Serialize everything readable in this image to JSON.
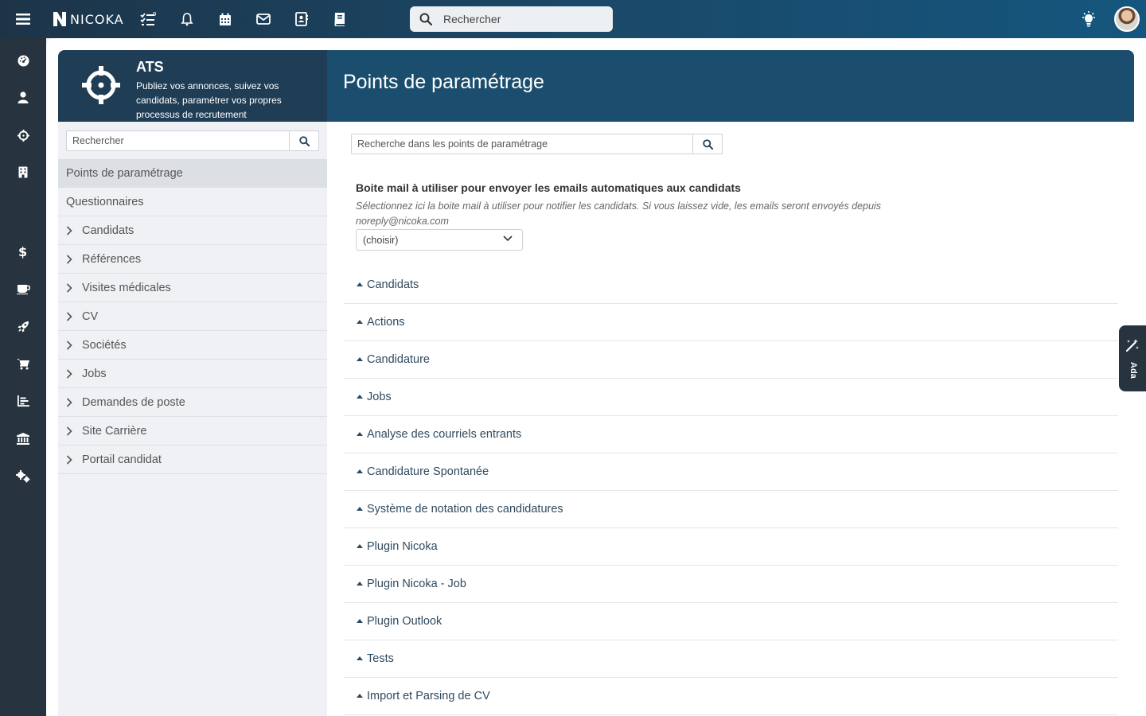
{
  "brand": {
    "name": "NICOKA"
  },
  "topbar": {
    "search_placeholder": "Rechercher",
    "icons": [
      "menu-icon",
      "tasks-icon",
      "bell-icon",
      "calendar-icon",
      "mail-icon",
      "contacts-icon",
      "book-icon",
      "lightbulb-icon"
    ]
  },
  "module": {
    "title": "ATS",
    "description": "Publiez vos annonces, suivez vos candidats, paramétrer vos propres processus de recrutement"
  },
  "left_search": {
    "placeholder": "Rechercher"
  },
  "nav": {
    "items": [
      {
        "label": "Points de paramétrage",
        "active": true,
        "chevron": false
      },
      {
        "label": "Questionnaires",
        "active": false,
        "chevron": false
      },
      {
        "label": "Candidats",
        "active": false,
        "chevron": true
      },
      {
        "label": "Références",
        "active": false,
        "chevron": true
      },
      {
        "label": "Visites médicales",
        "active": false,
        "chevron": true
      },
      {
        "label": "CV",
        "active": false,
        "chevron": true
      },
      {
        "label": "Sociétés",
        "active": false,
        "chevron": true
      },
      {
        "label": "Jobs",
        "active": false,
        "chevron": true
      },
      {
        "label": "Demandes de poste",
        "active": false,
        "chevron": true
      },
      {
        "label": "Site Carrière",
        "active": false,
        "chevron": true
      },
      {
        "label": "Portail candidat",
        "active": false,
        "chevron": true
      }
    ]
  },
  "content": {
    "title": "Points de paramétrage",
    "search_placeholder": "Recherche dans les points de paramétrage",
    "setting": {
      "label": "Boite mail à utiliser pour envoyer les emails automatiques aux candidats",
      "help": "Sélectionnez ici la boite mail à utiliser pour notifier les candidats. Si vous laissez vide, les emails seront envoyés depuis noreply@nicoka.com",
      "select_value": "(choisir)"
    },
    "sections": [
      "Candidats",
      "Actions",
      "Candidature",
      "Jobs",
      "Analyse des courriels entrants",
      "Candidature Spontanée",
      "Système de notation des candidatures",
      "Plugin Nicoka",
      "Plugin Nicoka - Job",
      "Plugin Outlook",
      "Tests",
      "Import et Parsing de CV"
    ]
  },
  "side_tab": {
    "label": "Ada"
  },
  "colors": {
    "topbar": "#1a4868",
    "rail": "#27333f",
    "module_header": "#1f3d55",
    "content_header": "#1b4e6e",
    "accent_text": "#2f4a5e"
  }
}
